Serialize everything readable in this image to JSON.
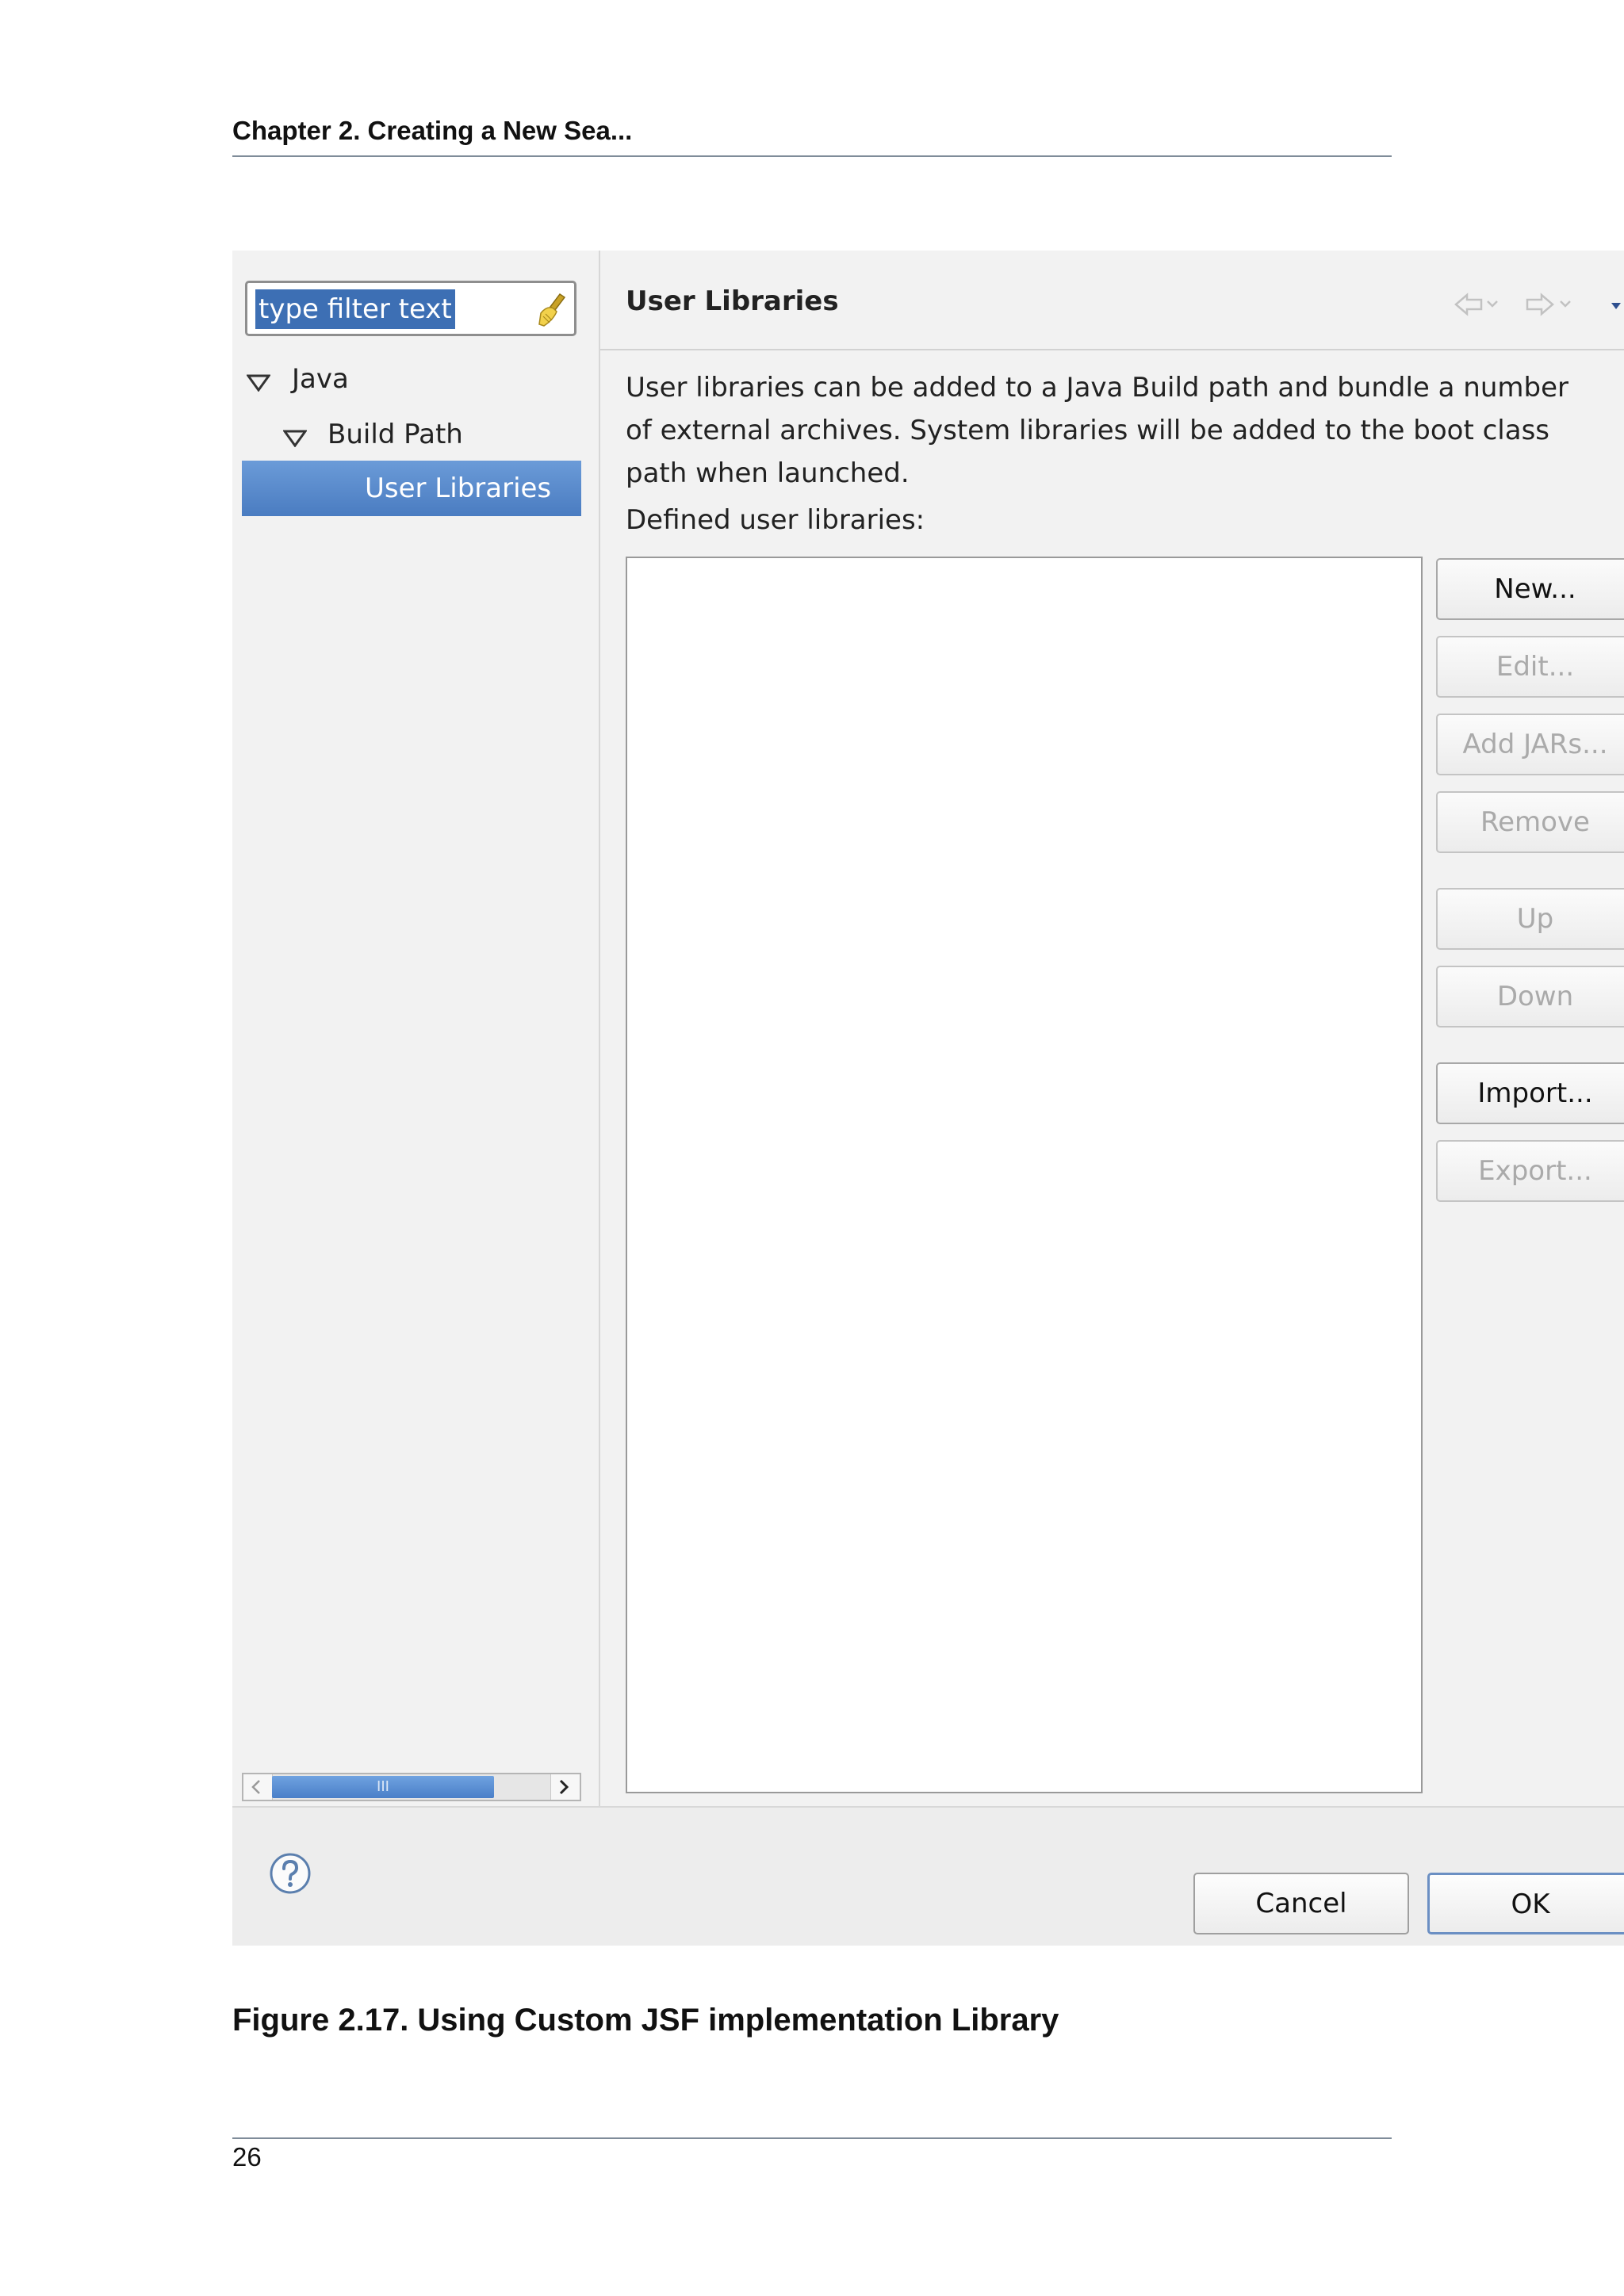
{
  "document": {
    "header": "Chapter 2. Creating a New Sea...",
    "caption": "Figure 2.17. Using Custom JSF implementation Library",
    "page_number": "26"
  },
  "dialog": {
    "filter": {
      "value": "type filter text",
      "clear_icon": "broom-clear-icon"
    },
    "tree": [
      {
        "label": "Java",
        "expanded": true
      },
      {
        "label": "Build Path",
        "expanded": true
      },
      {
        "label": "User Libraries",
        "selected": true
      }
    ],
    "title": "User Libraries",
    "description": "User libraries can be added to a Java Build path and bundle a number of external archives. System libraries will be added to the boot class path when launched.",
    "list_label": "Defined user libraries:",
    "buttons": {
      "new": "New...",
      "edit": "Edit...",
      "add_jars": "Add JARs...",
      "remove": "Remove",
      "up": "Up",
      "down": "Down",
      "import": "Import...",
      "export": "Export..."
    },
    "footer": {
      "cancel": "Cancel",
      "ok": "OK",
      "help_icon": "help-icon"
    },
    "colors": {
      "selection": "#4a7cc1",
      "background": "#f2f2f2"
    }
  }
}
